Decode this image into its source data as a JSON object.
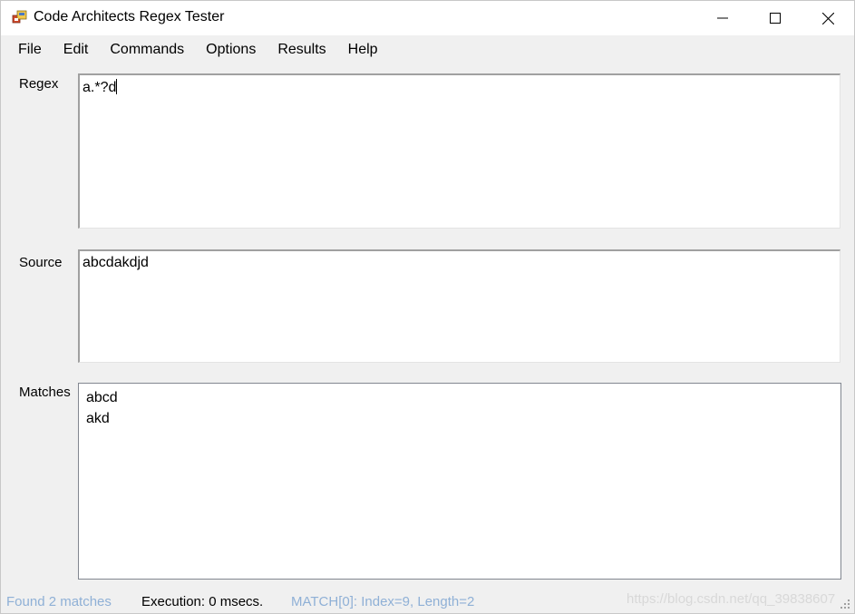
{
  "window": {
    "title": "Code Architects Regex Tester",
    "controls": {
      "minimize": "—",
      "maximize": "☐",
      "close": "✕"
    }
  },
  "menu": {
    "items": [
      {
        "label": "File"
      },
      {
        "label": "Edit"
      },
      {
        "label": "Commands"
      },
      {
        "label": "Options"
      },
      {
        "label": "Results"
      },
      {
        "label": "Help"
      }
    ]
  },
  "regex": {
    "label": "Regex",
    "value": "a.*?d"
  },
  "source": {
    "label": "Source",
    "value": "abcdakdjd"
  },
  "matches": {
    "label": "Matches",
    "items": [
      "abcd",
      "akd"
    ]
  },
  "status": {
    "found": "Found 2 matches",
    "execution": "Execution: 0 msecs.",
    "match_info": "MATCH[0]: Index=9, Length=2",
    "watermark": "https://blog.csdn.net/qq_39838607"
  },
  "colors": {
    "status_info": "#8fb0d6",
    "window_bg": "#f0f0f0"
  }
}
